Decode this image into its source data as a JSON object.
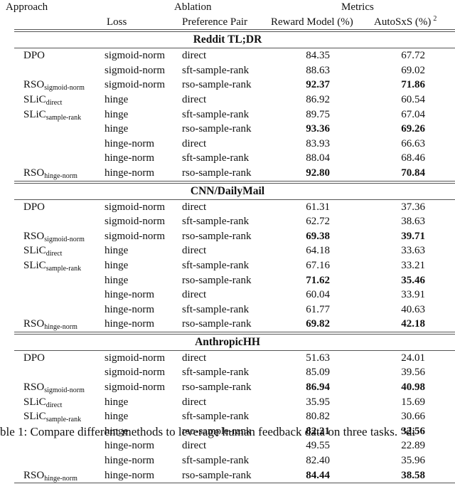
{
  "table": {
    "header": {
      "approach": "Approach",
      "ablation": "Ablation",
      "metrics": "Metrics",
      "loss": "Loss",
      "preference_pair": "Preference Pair",
      "reward_model": "Reward Model (%)",
      "autosxs": "AutoSxS (%)",
      "autosxs_footnote": "2"
    },
    "sections": [
      {
        "title": "Reddit TL;DR",
        "rows": [
          {
            "approach": "DPO",
            "approach_sub": "",
            "loss": "sigmoid-norm",
            "pair": "direct",
            "rm": "84.35",
            "sxs": "67.72",
            "bold": false
          },
          {
            "approach": "",
            "approach_sub": "",
            "loss": "sigmoid-norm",
            "pair": "sft-sample-rank",
            "rm": "88.63",
            "sxs": "69.02",
            "bold": false
          },
          {
            "approach": "RSO",
            "approach_sub": "sigmoid-norm",
            "loss": "sigmoid-norm",
            "pair": "rso-sample-rank",
            "rm": "92.37",
            "sxs": "71.86",
            "bold": true
          },
          {
            "approach": "SLiC",
            "approach_sub": "direct",
            "loss": "hinge",
            "pair": "direct",
            "rm": "86.92",
            "sxs": "60.54",
            "bold": false
          },
          {
            "approach": "SLiC",
            "approach_sub": "sample-rank",
            "loss": "hinge",
            "pair": "sft-sample-rank",
            "rm": "89.75",
            "sxs": "67.04",
            "bold": false
          },
          {
            "approach": "",
            "approach_sub": "",
            "loss": "hinge",
            "pair": "rso-sample-rank",
            "rm": "93.36",
            "sxs": "69.26",
            "bold": true
          },
          {
            "approach": "",
            "approach_sub": "",
            "loss": "hinge-norm",
            "pair": "direct",
            "rm": "83.93",
            "sxs": "66.63",
            "bold": false
          },
          {
            "approach": "",
            "approach_sub": "",
            "loss": "hinge-norm",
            "pair": "sft-sample-rank",
            "rm": "88.04",
            "sxs": "68.46",
            "bold": false
          },
          {
            "approach": "RSO",
            "approach_sub": "hinge-norm",
            "loss": "hinge-norm",
            "pair": "rso-sample-rank",
            "rm": "92.80",
            "sxs": "70.84",
            "bold": true
          }
        ]
      },
      {
        "title": "CNN/DailyMail",
        "rows": [
          {
            "approach": "DPO",
            "approach_sub": "",
            "loss": "sigmoid-norm",
            "pair": "direct",
            "rm": "61.31",
            "sxs": "37.36",
            "bold": false
          },
          {
            "approach": "",
            "approach_sub": "",
            "loss": "sigmoid-norm",
            "pair": "sft-sample-rank",
            "rm": "62.72",
            "sxs": "38.63",
            "bold": false
          },
          {
            "approach": "RSO",
            "approach_sub": "sigmoid-norm",
            "loss": "sigmoid-norm",
            "pair": "rso-sample-rank",
            "rm": "69.38",
            "sxs": "39.71",
            "bold": true
          },
          {
            "approach": "SLiC",
            "approach_sub": "direct",
            "loss": "hinge",
            "pair": "direct",
            "rm": "64.18",
            "sxs": "33.63",
            "bold": false
          },
          {
            "approach": "SLiC",
            "approach_sub": "sample-rank",
            "loss": "hinge",
            "pair": "sft-sample-rank",
            "rm": "67.16",
            "sxs": "33.21",
            "bold": false
          },
          {
            "approach": "",
            "approach_sub": "",
            "loss": "hinge",
            "pair": "rso-sample-rank",
            "rm": "71.62",
            "sxs": "35.46",
            "bold": true
          },
          {
            "approach": "",
            "approach_sub": "",
            "loss": "hinge-norm",
            "pair": "direct",
            "rm": "60.04",
            "sxs": "33.91",
            "bold": false
          },
          {
            "approach": "",
            "approach_sub": "",
            "loss": "hinge-norm",
            "pair": "sft-sample-rank",
            "rm": "61.77",
            "sxs": "40.63",
            "bold": false
          },
          {
            "approach": "RSO",
            "approach_sub": "hinge-norm",
            "loss": "hinge-norm",
            "pair": "rso-sample-rank",
            "rm": "69.82",
            "sxs": "42.18",
            "bold": true
          }
        ]
      },
      {
        "title": "AnthropicHH",
        "rows": [
          {
            "approach": "DPO",
            "approach_sub": "",
            "loss": "sigmoid-norm",
            "pair": "direct",
            "rm": "51.63",
            "sxs": "24.01",
            "bold": false
          },
          {
            "approach": "",
            "approach_sub": "",
            "loss": "sigmoid-norm",
            "pair": "sft-sample-rank",
            "rm": "85.09",
            "sxs": "39.56",
            "bold": false
          },
          {
            "approach": "RSO",
            "approach_sub": "sigmoid-norm",
            "loss": "sigmoid-norm",
            "pair": "rso-sample-rank",
            "rm": "86.94",
            "sxs": "40.98",
            "bold": true
          },
          {
            "approach": "SLiC",
            "approach_sub": "direct",
            "loss": "hinge",
            "pair": "direct",
            "rm": "35.95",
            "sxs": "15.69",
            "bold": false
          },
          {
            "approach": "SLiC",
            "approach_sub": "sample-rank",
            "loss": "hinge",
            "pair": "sft-sample-rank",
            "rm": "80.82",
            "sxs": "30.66",
            "bold": false
          },
          {
            "approach": "",
            "approach_sub": "",
            "loss": "hinge",
            "pair": "rso-sample-rank",
            "rm": "82.21",
            "sxs": "32.56",
            "bold": true
          },
          {
            "approach": "",
            "approach_sub": "",
            "loss": "hinge-norm",
            "pair": "direct",
            "rm": "49.55",
            "sxs": "22.89",
            "bold": false
          },
          {
            "approach": "",
            "approach_sub": "",
            "loss": "hinge-norm",
            "pair": "sft-sample-rank",
            "rm": "82.40",
            "sxs": "35.96",
            "bold": false
          },
          {
            "approach": "RSO",
            "approach_sub": "hinge-norm",
            "loss": "hinge-norm",
            "pair": "rso-sample-rank",
            "rm": "84.44",
            "sxs": "38.58",
            "bold": true
          }
        ]
      }
    ]
  },
  "caption": "ble 1:  Compare different methods to leverage human feedback data on three tasks. “di"
}
